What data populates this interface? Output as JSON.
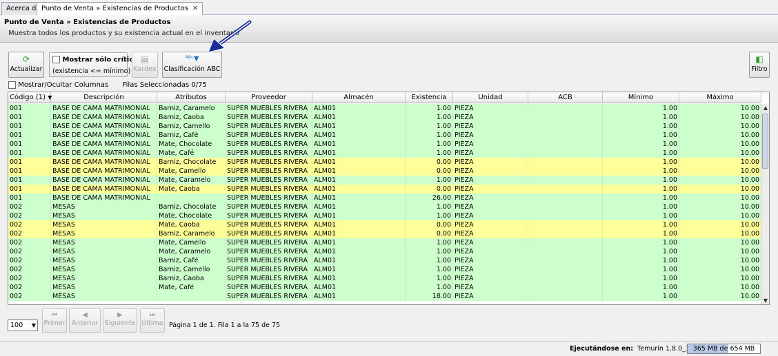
{
  "tabs": [
    {
      "label": "Acerca de"
    },
    {
      "label": "Punto de Venta » Existencias de Productos",
      "closable": true
    }
  ],
  "header": {
    "title": "Punto de Venta » Existencias de Productos",
    "subtitle": "Muestra todos los productos y su existencia actual en el inventario"
  },
  "toolbar": {
    "refresh_label": "Actualizar",
    "critical_label": "Mostrar sólo críticos",
    "critical_hint": "(existencia <= mínimo)",
    "kardex_label": "Kardex",
    "abc_label": "Clasificación ABC",
    "filter_label": "Filtro"
  },
  "grid_options": {
    "toggle_columns_label": "Mostrar/Ocultar Columnas",
    "selected_label": "Filas Seleccionadas",
    "selected_value": "0/75"
  },
  "columns": [
    "Código (1)",
    "Descripción",
    "Atributos",
    "Proveedor",
    "Almacén",
    "Existencia",
    "Unidad",
    "ACB",
    "Mínimo",
    "Máximo"
  ],
  "rows": [
    {
      "codigo": "001",
      "descripcion": "BASE DE CAMA MATRIMONIAL",
      "atributos": "Barniz, Caramelo",
      "proveedor": "SUPER MUEBLES RIVERA",
      "almacen": "ALM01",
      "existencia": "1.00",
      "unidad": "PIEZA",
      "acb": "",
      "minimo": "1.00",
      "maximo": "10.00",
      "status": "green"
    },
    {
      "codigo": "001",
      "descripcion": "BASE DE CAMA MATRIMONIAL",
      "atributos": "Barniz, Caoba",
      "proveedor": "SUPER MUEBLES RIVERA",
      "almacen": "ALM01",
      "existencia": "1.00",
      "unidad": "PIEZA",
      "acb": "",
      "minimo": "1.00",
      "maximo": "10.00",
      "status": "green"
    },
    {
      "codigo": "001",
      "descripcion": "BASE DE CAMA MATRIMONIAL",
      "atributos": "Barniz, Camello",
      "proveedor": "SUPER MUEBLES RIVERA",
      "almacen": "ALM01",
      "existencia": "1.00",
      "unidad": "PIEZA",
      "acb": "",
      "minimo": "1.00",
      "maximo": "10.00",
      "status": "green"
    },
    {
      "codigo": "001",
      "descripcion": "BASE DE CAMA MATRIMONIAL",
      "atributos": "Barniz, Café",
      "proveedor": "SUPER MUEBLES RIVERA",
      "almacen": "ALM01",
      "existencia": "1.00",
      "unidad": "PIEZA",
      "acb": "",
      "minimo": "1.00",
      "maximo": "10.00",
      "status": "green"
    },
    {
      "codigo": "001",
      "descripcion": "BASE DE CAMA MATRIMONIAL",
      "atributos": "Mate, Chocolate",
      "proveedor": "SUPER MUEBLES RIVERA",
      "almacen": "ALM01",
      "existencia": "1.00",
      "unidad": "PIEZA",
      "acb": "",
      "minimo": "1.00",
      "maximo": "10.00",
      "status": "green"
    },
    {
      "codigo": "001",
      "descripcion": "BASE DE CAMA MATRIMONIAL",
      "atributos": "Mate, Café",
      "proveedor": "SUPER MUEBLES RIVERA",
      "almacen": "ALM01",
      "existencia": "1.00",
      "unidad": "PIEZA",
      "acb": "",
      "minimo": "1.00",
      "maximo": "10.00",
      "status": "green"
    },
    {
      "codigo": "001",
      "descripcion": "BASE DE CAMA MATRIMONIAL",
      "atributos": "Barniz, Chocolate",
      "proveedor": "SUPER MUEBLES RIVERA",
      "almacen": "ALM01",
      "existencia": "0.00",
      "unidad": "PIEZA",
      "acb": "",
      "minimo": "1.00",
      "maximo": "10.00",
      "status": "yellow"
    },
    {
      "codigo": "001",
      "descripcion": "BASE DE CAMA MATRIMONIAL",
      "atributos": "Mate, Camello",
      "proveedor": "SUPER MUEBLES RIVERA",
      "almacen": "ALM01",
      "existencia": "0.00",
      "unidad": "PIEZA",
      "acb": "",
      "minimo": "1.00",
      "maximo": "10.00",
      "status": "yellow"
    },
    {
      "codigo": "001",
      "descripcion": "BASE DE CAMA MATRIMONIAL",
      "atributos": "Mate, Caramelo",
      "proveedor": "SUPER MUEBLES RIVERA",
      "almacen": "ALM01",
      "existencia": "1.00",
      "unidad": "PIEZA",
      "acb": "",
      "minimo": "1.00",
      "maximo": "10.00",
      "status": "green"
    },
    {
      "codigo": "001",
      "descripcion": "BASE DE CAMA MATRIMONIAL",
      "atributos": "Mate, Caoba",
      "proveedor": "SUPER MUEBLES RIVERA",
      "almacen": "ALM01",
      "existencia": "0.00",
      "unidad": "PIEZA",
      "acb": "",
      "minimo": "1.00",
      "maximo": "10.00",
      "status": "yellow"
    },
    {
      "codigo": "001",
      "descripcion": "BASE DE CAMA MATRIMONIAL",
      "atributos": "",
      "proveedor": "SUPER MUEBLES RIVERA",
      "almacen": "ALM01",
      "existencia": "26.00",
      "unidad": "PIEZA",
      "acb": "",
      "minimo": "1.00",
      "maximo": "10.00",
      "status": "green"
    },
    {
      "codigo": "002",
      "descripcion": "MESAS",
      "atributos": "Barniz, Chocolate",
      "proveedor": "SUPER MUEBLES RIVERA",
      "almacen": "ALM01",
      "existencia": "1.00",
      "unidad": "PIEZA",
      "acb": "",
      "minimo": "1.00",
      "maximo": "10.00",
      "status": "green"
    },
    {
      "codigo": "002",
      "descripcion": "MESAS",
      "atributos": "Mate, Chocolate",
      "proveedor": "SUPER MUEBLES RIVERA",
      "almacen": "ALM01",
      "existencia": "1.00",
      "unidad": "PIEZA",
      "acb": "",
      "minimo": "1.00",
      "maximo": "10.00",
      "status": "green"
    },
    {
      "codigo": "002",
      "descripcion": "MESAS",
      "atributos": "Mate, Caoba",
      "proveedor": "SUPER MUEBLES RIVERA",
      "almacen": "ALM01",
      "existencia": "0.00",
      "unidad": "PIEZA",
      "acb": "",
      "minimo": "1.00",
      "maximo": "10.00",
      "status": "yellow"
    },
    {
      "codigo": "002",
      "descripcion": "MESAS",
      "atributos": "Barniz, Caramelo",
      "proveedor": "SUPER MUEBLES RIVERA",
      "almacen": "ALM01",
      "existencia": "0.00",
      "unidad": "PIEZA",
      "acb": "",
      "minimo": "1.00",
      "maximo": "10.00",
      "status": "yellow"
    },
    {
      "codigo": "002",
      "descripcion": "MESAS",
      "atributos": "Mate, Camello",
      "proveedor": "SUPER MUEBLES RIVERA",
      "almacen": "ALM01",
      "existencia": "1.00",
      "unidad": "PIEZA",
      "acb": "",
      "minimo": "1.00",
      "maximo": "10.00",
      "status": "green"
    },
    {
      "codigo": "002",
      "descripcion": "MESAS",
      "atributos": "Mate, Caramelo",
      "proveedor": "SUPER MUEBLES RIVERA",
      "almacen": "ALM01",
      "existencia": "1.00",
      "unidad": "PIEZA",
      "acb": "",
      "minimo": "1.00",
      "maximo": "10.00",
      "status": "green"
    },
    {
      "codigo": "002",
      "descripcion": "MESAS",
      "atributos": "Barniz, Café",
      "proveedor": "SUPER MUEBLES RIVERA",
      "almacen": "ALM01",
      "existencia": "1.00",
      "unidad": "PIEZA",
      "acb": "",
      "minimo": "1.00",
      "maximo": "10.00",
      "status": "green"
    },
    {
      "codigo": "002",
      "descripcion": "MESAS",
      "atributos": "Barniz, Camello",
      "proveedor": "SUPER MUEBLES RIVERA",
      "almacen": "ALM01",
      "existencia": "1.00",
      "unidad": "PIEZA",
      "acb": "",
      "minimo": "1.00",
      "maximo": "10.00",
      "status": "green"
    },
    {
      "codigo": "002",
      "descripcion": "MESAS",
      "atributos": "Barniz, Caoba",
      "proveedor": "SUPER MUEBLES RIVERA",
      "almacen": "ALM01",
      "existencia": "1.00",
      "unidad": "PIEZA",
      "acb": "",
      "minimo": "1.00",
      "maximo": "10.00",
      "status": "green"
    },
    {
      "codigo": "002",
      "descripcion": "MESAS",
      "atributos": "Mate, Café",
      "proveedor": "SUPER MUEBLES RIVERA",
      "almacen": "ALM01",
      "existencia": "1.00",
      "unidad": "PIEZA",
      "acb": "",
      "minimo": "1.00",
      "maximo": "10.00",
      "status": "green"
    },
    {
      "codigo": "002",
      "descripcion": "MESAS",
      "atributos": "",
      "proveedor": "SUPER MUEBLES RIVERA",
      "almacen": "ALM01",
      "existencia": "18.00",
      "unidad": "PIEZA",
      "acb": "",
      "minimo": "1.00",
      "maximo": "10.00",
      "status": "green"
    }
  ],
  "pager": {
    "page_size": "100",
    "first_label": "Primer",
    "prev_label": "Anterior",
    "next_label": "Siguiente",
    "last_label": "Última",
    "info": "Página 1 de 1. Fila 1 a la 75 de 75"
  },
  "statusbar": {
    "running_label": "Ejecutándose en:",
    "runtime": "Temurin 1.8.0_392",
    "memory_text": "365 MB de 654 MB",
    "memory_fraction": 0.558
  },
  "colors": {
    "row_ok": "#ccffcc",
    "row_critical": "#ffff99",
    "annotation_arrow": "#1a2d9c"
  }
}
